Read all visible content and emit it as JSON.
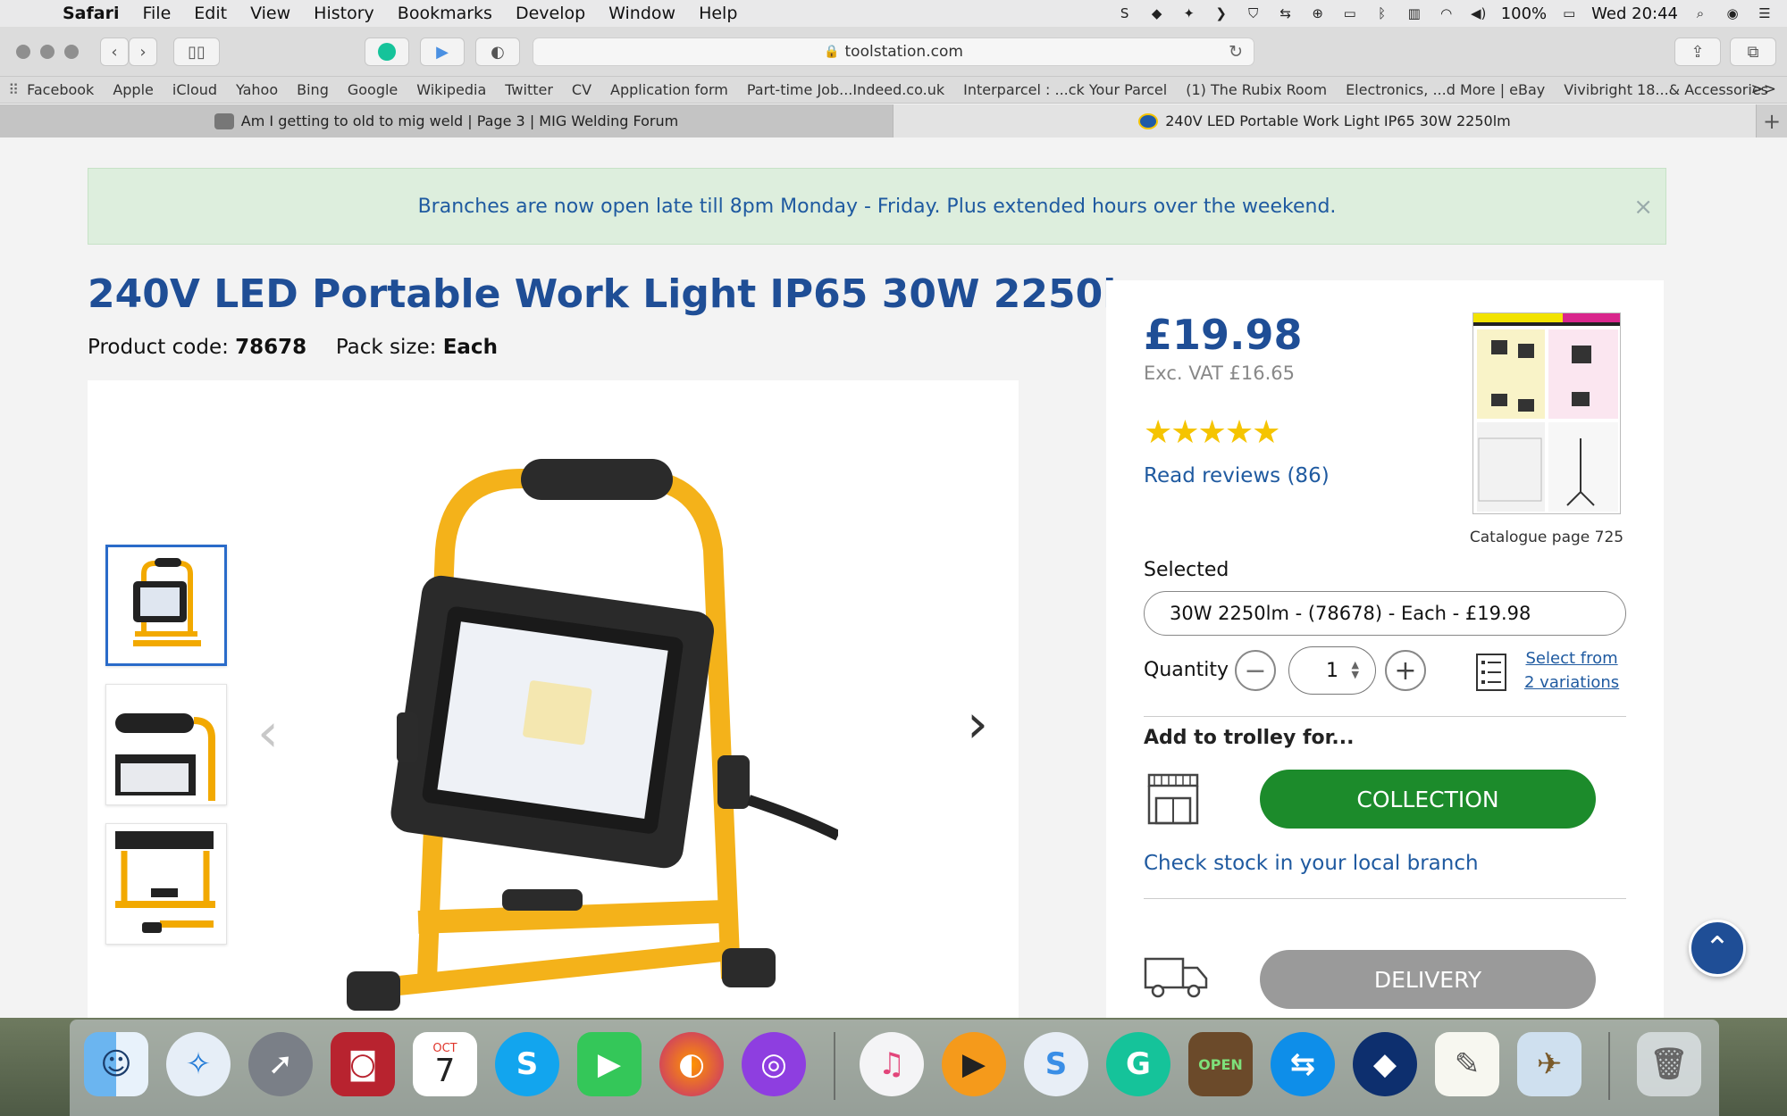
{
  "menubar": {
    "app": "Safari",
    "items": [
      "File",
      "Edit",
      "View",
      "History",
      "Bookmarks",
      "Develop",
      "Window",
      "Help"
    ],
    "battery": "100%",
    "clock": "Wed 20:44"
  },
  "browser": {
    "url": "toolstation.com",
    "bookmarks": [
      "Facebook",
      "Apple",
      "iCloud",
      "Yahoo",
      "Bing",
      "Google",
      "Wikipedia",
      "Twitter",
      "CV",
      "Application form",
      "Part-time Job...Indeed.co.uk",
      "Interparcel : ...ck Your Parcel",
      "(1) The Rubix Room",
      "Electronics, ...d More | eBay",
      "Vivibright 18...& Accessories"
    ],
    "bookmarks_more": ">>",
    "tabs": [
      {
        "title": "Am I getting to old to mig weld | Page 3 | MIG Welding Forum",
        "active": false
      },
      {
        "title": "240V LED Portable Work Light IP65 30W 2250lm",
        "active": true
      }
    ]
  },
  "banner": {
    "text": "Branches are now open late till 8pm Monday - Friday. Plus extended hours over the weekend.",
    "close": "×"
  },
  "product": {
    "title": "240V LED Portable Work Light IP65 30W 2250lm",
    "code_label": "Product code:",
    "code": "78678",
    "pack_label": "Pack size:",
    "pack": "Each"
  },
  "buy": {
    "price": "£19.98",
    "ex_vat": "Exc. VAT £16.65",
    "rating": 4.5,
    "stars": "★★★★★",
    "reviews": "Read reviews (86)",
    "catalogue_label": "Catalogue page 725",
    "selected_label": "Selected",
    "selected_value": "30W 2250lm - (78678) - Each - £19.98",
    "quantity_label": "Quantity",
    "quantity": "1",
    "minus": "−",
    "plus": "+",
    "variations_line1": "Select from",
    "variations_line2": "2 variations",
    "add_to_trolley": "Add to trolley for...",
    "collection_button": "COLLECTION",
    "check_stock": "Check stock in your local branch",
    "delivery_button": "DELIVERY"
  },
  "colors": {
    "brand_blue": "#1f4e96",
    "link_blue": "#1f5aa0",
    "collection_green": "#1c8b2b",
    "banner_bg": "#ddeedd",
    "star_yellow": "#f5c400"
  },
  "dock": {
    "calendar_month": "OCT",
    "calendar_day": "7",
    "open_sign": "OPEN",
    "icons": [
      "finder-icon",
      "safari-icon",
      "launchpad-icon",
      "photo-booth-icon",
      "calendar-icon",
      "skype-icon",
      "facetime-icon",
      "firefox-icon",
      "podcasts-icon",
      "itunes-icon",
      "infuse-icon",
      "simplenote-icon",
      "grammarly-icon",
      "open-sign-icon",
      "teamviewer-icon",
      "dropbox-icon",
      "textedit-icon",
      "preview-icon",
      "trash-icon"
    ]
  }
}
